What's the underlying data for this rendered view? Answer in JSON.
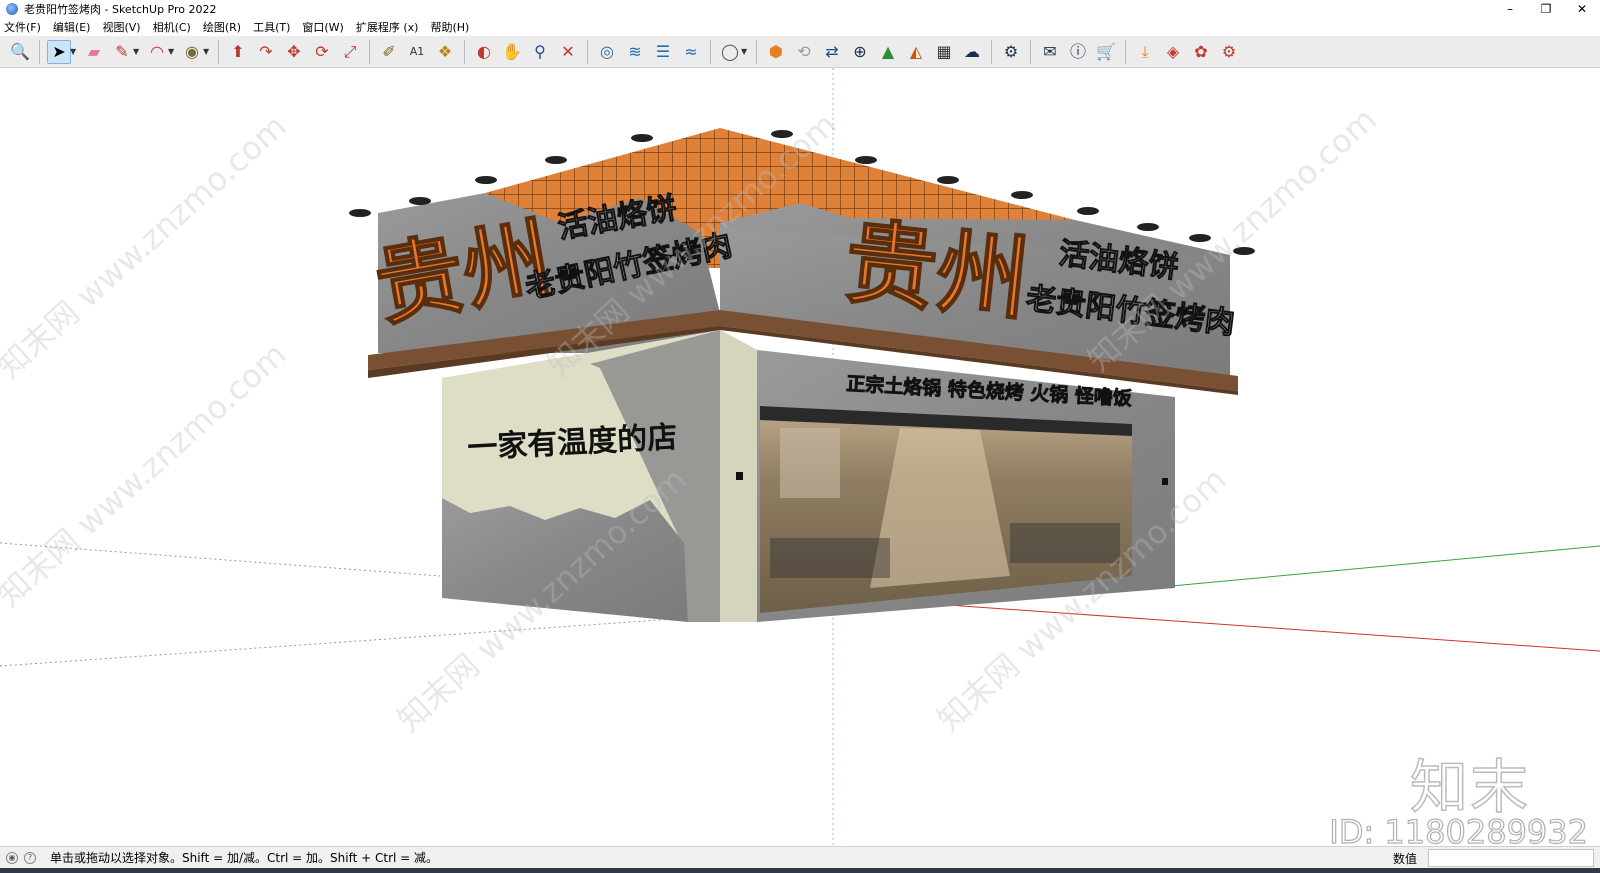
{
  "window": {
    "title": "老贵阳竹签烤肉 - SketchUp Pro 2022",
    "controls": [
      "–",
      "❐",
      "✕"
    ]
  },
  "menu": [
    "文件(F)",
    "编辑(E)",
    "视图(V)",
    "相机(C)",
    "绘图(R)",
    "工具(T)",
    "窗口(W)",
    "扩展程序 (x)",
    "帮助(H)"
  ],
  "toolbar": {
    "groups": [
      [
        "zoom-extents-icon"
      ],
      [
        "select-icon",
        "eraser-icon",
        "pencil-line-icon",
        "arc-icon",
        "paint-bucket-icon"
      ],
      [
        "push-pull-icon",
        "follow-me-icon",
        "move-icon",
        "rotate-icon",
        "scale-icon"
      ],
      [
        "tape-measure-icon",
        "text-icon",
        "paint-icon"
      ],
      [
        "orbit-icon",
        "pan-icon",
        "zoom-icon",
        "zoom-window-icon"
      ],
      [
        "section-plane-icon",
        "hide-icon",
        "layers-icon",
        "styles-icon"
      ],
      [
        "account-icon"
      ],
      [
        "warehouse-icon",
        "refresh-icon",
        "transfer-icon",
        "add-icon",
        "tree-icon",
        "terrain-icon",
        "checker-icon",
        "cloud-icon"
      ],
      [
        "settings-icon"
      ],
      [
        "mail-icon",
        "info-icon",
        "cart-icon"
      ],
      [
        "import-icon",
        "stack-icon",
        "plugin-icon",
        "gear-icon"
      ]
    ]
  },
  "model": {
    "sign_big": "贵州",
    "sign_line1": "活油烙饼",
    "sign_line2": "老贵阳竹签烤肉",
    "front_wall_slogan": "一家有温度的店",
    "menu_banner": "正宗土烙锅  特色烧烤  火锅  怪噜饭"
  },
  "watermarks": {
    "diagonal": "知末网 www.znzmo.com",
    "logo": "知末",
    "id": "ID: 1180289932"
  },
  "status": {
    "hint": "单击或拖动以选择对象。Shift = 加/减。Ctrl = 加。Shift + Ctrl = 减。",
    "measurements_label": "数值",
    "measurements_value": ""
  },
  "colors": {
    "accent_orange": "#e8772c",
    "concrete": "#8d8d8d",
    "wood": "#7a5034"
  }
}
